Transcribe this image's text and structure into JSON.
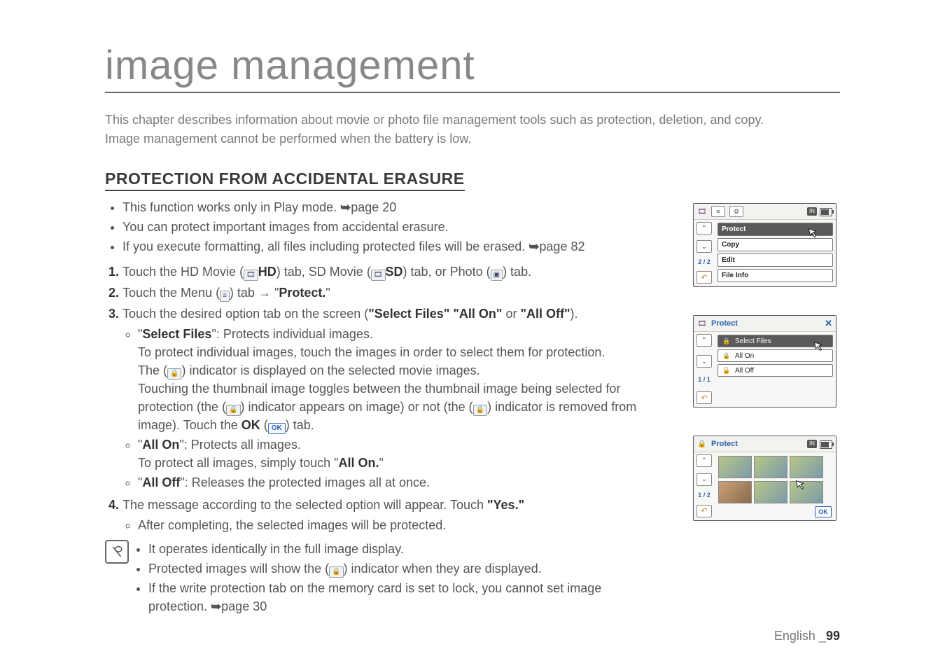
{
  "title": "image management",
  "intro": [
    "This chapter describes information about movie or photo file management tools such as protection, deletion, and copy.",
    "Image management cannot be performed when the battery is low."
  ],
  "section_title": "PROTECTION FROM ACCIDENTAL ERASURE",
  "notes_top": [
    {
      "t": "This function works only in Play mode. ",
      "arrow": "➥",
      "ref": "page 20"
    },
    {
      "t": "You can protect important images from accidental erasure."
    },
    {
      "t": "If you execute formatting, all files including protected files will be erased. ",
      "arrow": "➥",
      "ref": "page 82"
    }
  ],
  "steps": {
    "s1_prefix": "Touch the HD Movie (",
    "s1_hd": "HD",
    "s1_mid1": ") tab, SD Movie (",
    "s1_sd": "SD",
    "s1_mid2": ") tab, or Photo (",
    "s1_suffix": ") tab.",
    "s2_prefix": "Touch the Menu (",
    "s2_suffix": ") tab → \"",
    "s2_target": "Protect.",
    "s2_close": "\"",
    "s3_prefix": "Touch the desired option tab on the screen (",
    "s3_opts": "\"Select Files\" \"All On\"",
    "s3_or": " or ",
    "s3_opt3": "\"All Off\"",
    "s3_close": ").",
    "sub_sf_name": "Select Files",
    "sub_sf_rest": "\": Protects individual images.",
    "sub_sf_p1": "To protect individual images, touch the images in order to select them for protection.",
    "sub_sf_p2a": "The (",
    "sub_sf_p2b": ") indicator is displayed on the selected movie images.",
    "sub_sf_p3a": "Touching the thumbnail image toggles between the thumbnail image being selected for protection (the (",
    "sub_sf_p3b": ") indicator appears on image) or not (the (",
    "sub_sf_p3c": ") indicator is removed from image). Touch the ",
    "sub_sf_ok": "OK",
    "sub_sf_p3d": " (",
    "sub_sf_p3e": ") tab.",
    "sub_ao_name": "All On",
    "sub_ao_rest": "\": Protects all images.",
    "sub_ao_p1": "To protect all images, simply touch \"",
    "sub_ao_p1b": "All On.",
    "sub_ao_p1c": "\"",
    "sub_af_name": "All Off",
    "sub_af_rest": "\": Releases the protected images all at once.",
    "s4_prefix": "The message according to the selected option will appear. Touch ",
    "s4_yes": "\"Yes.\"",
    "s4_sub": "After completing, the selected images will be protected."
  },
  "notes_bottom": [
    "It operates identically in the full image display.",
    {
      "a": "Protected images will show the (",
      "b": ") indicator when they are displayed."
    },
    {
      "a": "If the write protection tab on the memory card is set to lock, you cannot set image protection. ",
      "arrow": "➥",
      "ref": "page 30"
    }
  ],
  "shot1": {
    "page": "2 / 2",
    "items": [
      "Protect",
      "Copy",
      "Edit",
      "File Info"
    ],
    "storage": "IN"
  },
  "shot2": {
    "title": "Protect",
    "page": "1 / 1",
    "options": [
      "Select Files",
      "All On",
      "All Off"
    ]
  },
  "shot3": {
    "title": "Protect",
    "page": "1 / 2",
    "storage": "IN",
    "ok": "OK"
  },
  "footer": {
    "lang": "English",
    "sep": "_",
    "page": "99"
  }
}
